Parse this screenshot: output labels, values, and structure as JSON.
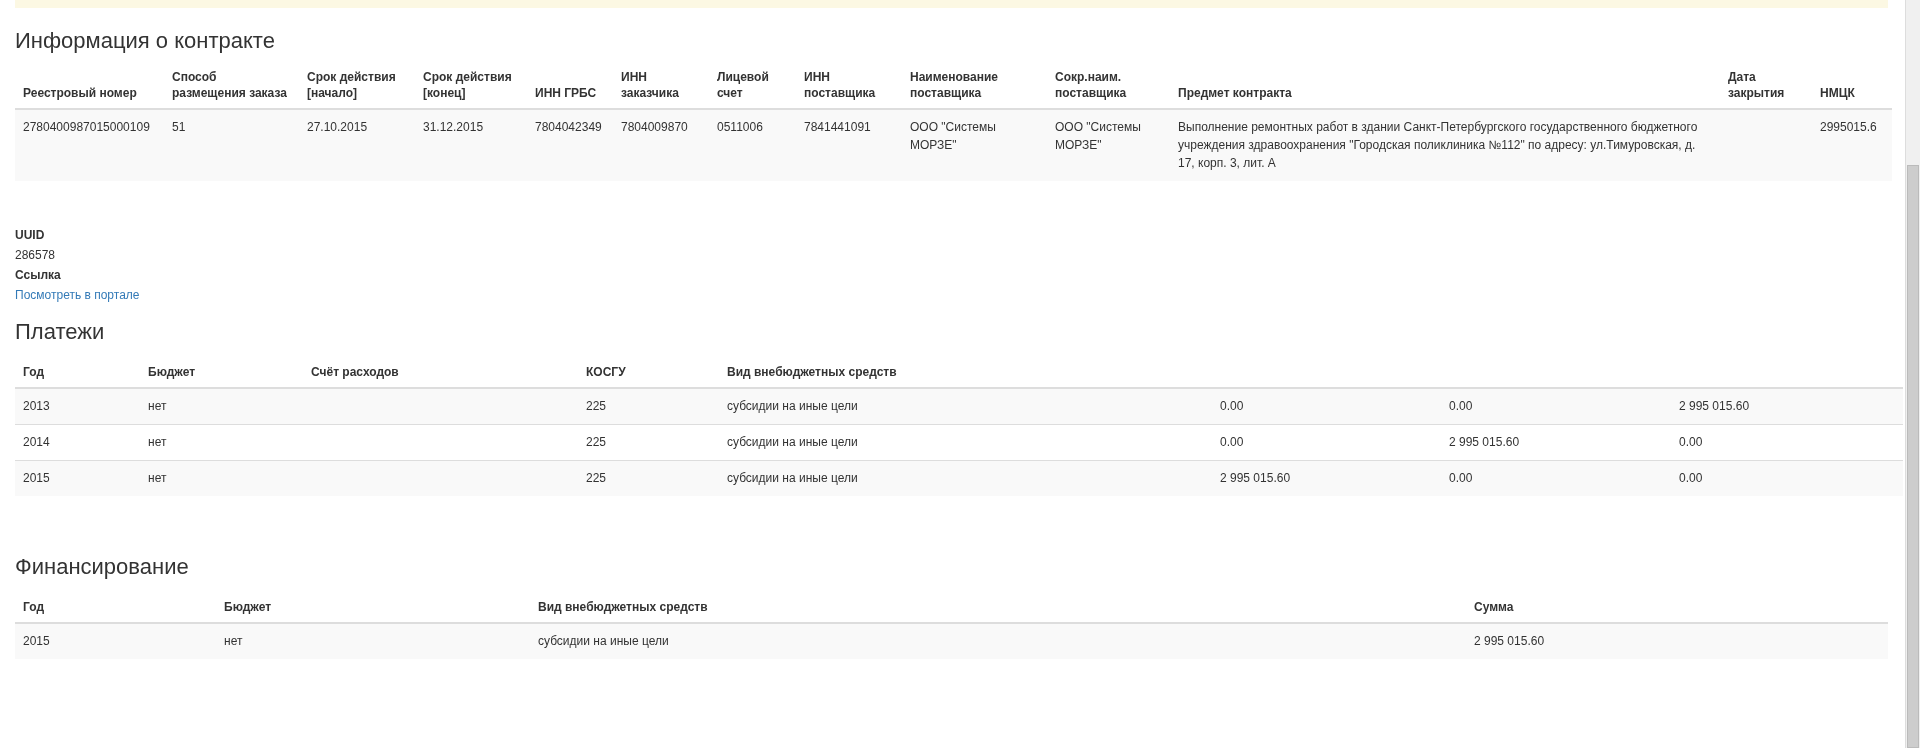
{
  "contract": {
    "title": "Информация о контракте",
    "columns": [
      "Реестровый номер",
      "Способ размещения заказа",
      "Срок действия [начало]",
      "Срок действия [конец]",
      "ИНН ГРБС",
      "ИНН заказчика",
      "Лицевой счет",
      "ИНН поставщика",
      "Наименование поставщика",
      "Сокр.наим. поставщика",
      "Предмет контракта",
      "Дата закрытия",
      "НМЦК"
    ],
    "rows": [
      [
        "2780400987015000109",
        "51",
        "27.10.2015",
        "31.12.2015",
        "7804042349",
        "7804009870",
        "0511006",
        "7841441091",
        "ООО \"Системы МОРЗЕ\"",
        "ООО \"Системы МОРЗЕ\"",
        "Выполнение ремонтных работ в здании Санкт-Петербургского государственного бюджетного учреждения здравоохранения \"Городская поликлиника №112\" по адресу: ул.Тимуровская, д. 17, корп. 3, лит. А",
        "",
        "2995015.6"
      ]
    ]
  },
  "details": [
    {
      "label": "UUID",
      "value": "286578",
      "kind": "text"
    },
    {
      "label": "Ссылка",
      "value": "Посмотреть в портале",
      "kind": "link"
    }
  ],
  "payments": {
    "title": "Платежи",
    "columns": [
      "Год",
      "Бюджет",
      "Счёт расходов",
      "КОСГУ",
      "Вид внебюджетных средств",
      "",
      "",
      ""
    ],
    "rows": [
      [
        "2013",
        "нет",
        "",
        "225",
        "субсидии на иные цели",
        "0.00",
        "0.00",
        "2 995 015.60"
      ],
      [
        "2014",
        "нет",
        "",
        "225",
        "субсидии на иные цели",
        "0.00",
        "2 995 015.60",
        "0.00"
      ],
      [
        "2015",
        "нет",
        "",
        "225",
        "субсидии на иные цели",
        "2 995 015.60",
        "0.00",
        "0.00"
      ]
    ]
  },
  "financing": {
    "title": "Финансирование",
    "columns": [
      "Год",
      "Бюджет",
      "Вид внебюджетных средств",
      "Сумма"
    ],
    "rows": [
      [
        "2015",
        "нет",
        "субсидии на иные цели",
        "2 995 015.60"
      ]
    ]
  }
}
